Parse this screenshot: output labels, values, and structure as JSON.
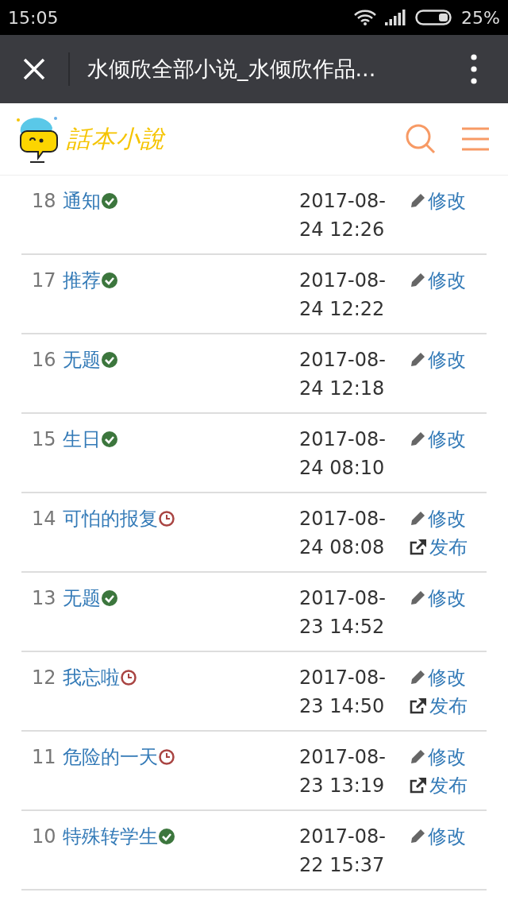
{
  "status_bar": {
    "time": "15:05",
    "battery": "25%"
  },
  "toolbar": {
    "title": "水倾欣全部小说_水倾欣作品..."
  },
  "site": {
    "logo": "話本小說"
  },
  "chapters": [
    {
      "number": "18",
      "title": "通知",
      "kind": "published",
      "date": [
        "2017-08-",
        "24 12:26"
      ],
      "actions": [
        {
          "kind": "edit",
          "label": "修改"
        }
      ]
    },
    {
      "number": "17",
      "title": "推荐",
      "kind": "published",
      "date": [
        "2017-08-",
        "24 12:22"
      ],
      "actions": [
        {
          "kind": "edit",
          "label": "修改"
        }
      ]
    },
    {
      "number": "16",
      "title": "无题",
      "kind": "published",
      "date": [
        "2017-08-",
        "24 12:18"
      ],
      "actions": [
        {
          "kind": "edit",
          "label": "修改"
        }
      ]
    },
    {
      "number": "15",
      "title": "生日",
      "kind": "published",
      "date": [
        "2017-08-",
        "24 08:10"
      ],
      "actions": [
        {
          "kind": "edit",
          "label": "修改"
        }
      ]
    },
    {
      "number": "14",
      "title": "可怕的报复",
      "kind": "scheduled",
      "date": [
        "2017-08-",
        "24 08:08"
      ],
      "actions": [
        {
          "kind": "edit",
          "label": "修改"
        },
        {
          "kind": "publish",
          "label": "发布"
        }
      ]
    },
    {
      "number": "13",
      "title": "无题",
      "kind": "published",
      "date": [
        "2017-08-",
        "23 14:52"
      ],
      "actions": [
        {
          "kind": "edit",
          "label": "修改"
        }
      ]
    },
    {
      "number": "12",
      "title": "我忘啦",
      "kind": "scheduled",
      "date": [
        "2017-08-",
        "23 14:50"
      ],
      "actions": [
        {
          "kind": "edit",
          "label": "修改"
        },
        {
          "kind": "publish",
          "label": "发布"
        }
      ]
    },
    {
      "number": "11",
      "title": "危险的一天",
      "kind": "scheduled",
      "date": [
        "2017-08-",
        "23 13:19"
      ],
      "actions": [
        {
          "kind": "edit",
          "label": "修改"
        },
        {
          "kind": "publish",
          "label": "发布"
        }
      ]
    },
    {
      "number": "10",
      "title": "特殊转学生",
      "kind": "published",
      "date": [
        "2017-08-",
        "22 15:37"
      ],
      "actions": [
        {
          "kind": "edit",
          "label": "修改"
        }
      ]
    }
  ]
}
